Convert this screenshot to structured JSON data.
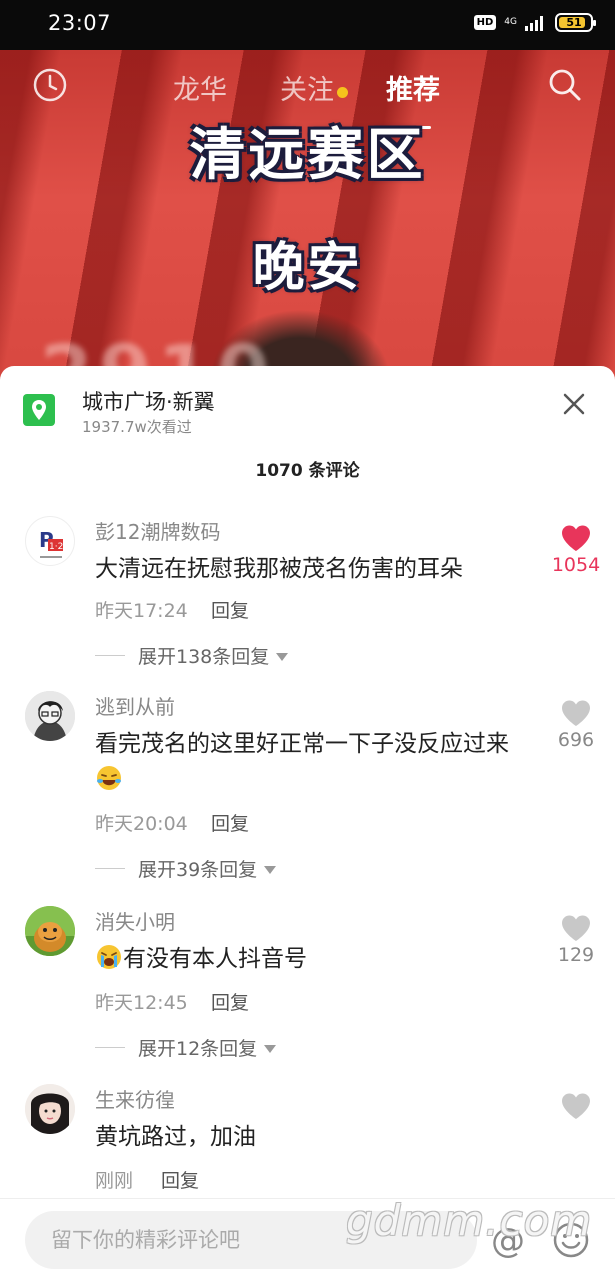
{
  "status_bar": {
    "time": "23:07",
    "hd": "HD",
    "network": "4G",
    "battery": "51"
  },
  "top_nav": {
    "tabs": [
      {
        "label": "龙华",
        "active": false
      },
      {
        "label": "关注",
        "active": false,
        "has_dot": true
      },
      {
        "label": "推荐",
        "active": true
      }
    ],
    "left_icon": "clock-icon",
    "right_icon": "search-icon"
  },
  "video": {
    "caption_line1": "清远赛区",
    "caption_line2": "晚安",
    "background_text": "2910"
  },
  "location": {
    "name": "城市广场·新翼",
    "views": "1937.7w次看过"
  },
  "comment_count": "1070 条评论",
  "comments": [
    {
      "user": "彭12潮牌数码",
      "text": "大清远在抚慰我那被茂名伤害的耳朵",
      "time": "昨天17:24",
      "reply_label": "回复",
      "expand": "展开138条回复",
      "likes": "1054",
      "liked": true
    },
    {
      "user": "逃到从前",
      "text": "看完茂名的这里好正常一下子没反应过来",
      "time": "昨天20:04",
      "reply_label": "回复",
      "expand": "展开39条回复",
      "likes": "696",
      "liked": false
    },
    {
      "user": "消失小明",
      "text": "有没有本人抖音号",
      "time": "昨天12:45",
      "reply_label": "回复",
      "expand": "展开12条回复",
      "likes": "129",
      "liked": false
    },
    {
      "user": "生来彷徨",
      "text": "黄坑路过，加油",
      "time": "刚刚",
      "reply_label": "回复",
      "likes": "",
      "liked": false
    }
  ],
  "input": {
    "placeholder": "留下你的精彩评论吧",
    "at_symbol": "@"
  },
  "watermark": "gdmm.com",
  "colors": {
    "like_active": "#e8355b",
    "location_pin": "#2dbf4e",
    "tab_dot": "#f5c31c"
  }
}
